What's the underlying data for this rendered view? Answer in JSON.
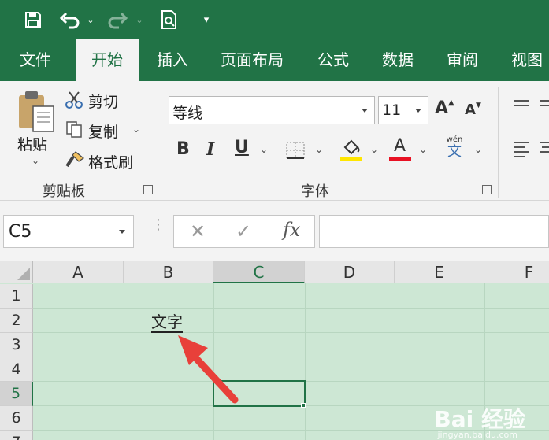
{
  "ribbon_tabs": [
    "文件",
    "开始",
    "插入",
    "页面布局",
    "公式",
    "数据",
    "审阅",
    "视图"
  ],
  "active_tab": "开始",
  "clipboard": {
    "paste_label": "粘贴",
    "cut_label": "剪切",
    "copy_label": "复制",
    "format_painter_label": "格式刷",
    "group_label": "剪贴板"
  },
  "font": {
    "font_name": "等线",
    "font_size": "11",
    "group_label": "字体",
    "bold": "B",
    "italic": "I",
    "underline": "U",
    "phonetic_top": "wén",
    "phonetic_bottom": "文",
    "highlight_color": "#ffe600",
    "font_color": "#e81123"
  },
  "formula_bar": {
    "name_box": "C5",
    "fx_label": "fx",
    "formula_value": ""
  },
  "sheet": {
    "columns": [
      "A",
      "B",
      "C",
      "D",
      "E",
      "F"
    ],
    "rows": [
      "1",
      "2",
      "3",
      "4",
      "5",
      "6",
      "7"
    ],
    "selected_column": "C",
    "selected_row": "5",
    "cell_b2_text": "文字"
  },
  "colors": {
    "accent": "#217346",
    "sheet_bg": "#cde7d4",
    "arrow": "#e8403a"
  },
  "watermark": {
    "text": "Bai 经验",
    "sub": "jingyan.baidu.com"
  }
}
